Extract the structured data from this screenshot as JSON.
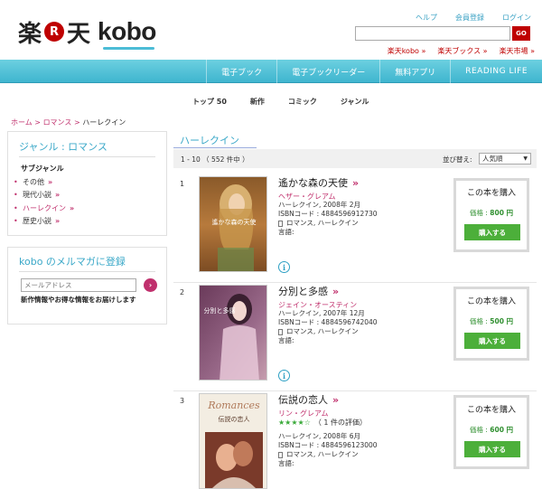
{
  "header": {
    "logo_rakuten": "楽",
    "logo_r": "R",
    "logo_ten": "天",
    "logo_kobo": "kobo",
    "top_links": [
      "ヘルプ",
      "会員登録",
      "ログイン"
    ],
    "search_value": "",
    "search_button": "GO",
    "site_links": [
      "楽天kobo »",
      "楽天ブックス »",
      "楽天市場 »"
    ]
  },
  "nav": {
    "items": [
      "電子ブック",
      "電子ブックリーダー",
      "無料アプリ",
      "READING LIFE"
    ],
    "color": "#4cbcd6"
  },
  "subnav": [
    "トップ 50",
    "新作",
    "コミック",
    "ジャンル"
  ],
  "breadcrumb": {
    "home": "ホーム",
    "sep1": " > ",
    "romance": "ロマンス",
    "sep2": " > ",
    "current": "ハーレクイン"
  },
  "sidebar": {
    "genre_title": "ジャンル : ロマンス",
    "subgenre_label": "サブジャンル",
    "subgenres": [
      {
        "label": "その他",
        "arrow": "»"
      },
      {
        "label": "現代小説",
        "arrow": "»"
      },
      {
        "label": "ハーレクイン",
        "arrow": "»"
      },
      {
        "label": "歴史小説",
        "arrow": "»"
      }
    ],
    "bullet": "•",
    "newsletter_title": "kobo のメルマガに登録",
    "email_placeholder": "メールアドレス",
    "newsletter_desc": "新作情報やお得な情報をお届けします",
    "go_arrow": "›"
  },
  "main": {
    "title": "ハーレクイン",
    "results": "1 - 10 （ 552 件中 ）",
    "sort_label": "並び替え:",
    "sort_value": "人気順",
    "sort_chevron": "▼"
  },
  "books": [
    {
      "num": "1",
      "title": "遙かな森の天使",
      "arrow": "»",
      "author": "ヘザー・グレアム",
      "rating": "",
      "publisher": "ハーレクイン, 2008年 2月",
      "isbn": "ISBNコード : 4884596912730",
      "genres": "ロマンス, ハーレクイン",
      "lang": "言語:",
      "cover_text": "遙かな森の天使",
      "buy_title": "この本を購入",
      "price_label": "価格 :",
      "price": "800 円",
      "buy_button": "購入する"
    },
    {
      "num": "2",
      "title": "分別と多感",
      "arrow": "»",
      "author": "ジェイン・オースティン",
      "rating": "",
      "publisher": "ハーレクイン, 2007年 12月",
      "isbn": "ISBNコード : 4884596742040",
      "genres": "ロマンス, ハーレクイン",
      "lang": "言語:",
      "cover_text": "分別と多感",
      "buy_title": "この本を購入",
      "price_label": "価格 :",
      "price": "500 円",
      "buy_button": "購入する"
    },
    {
      "num": "3",
      "title": "伝説の恋人",
      "arrow": "»",
      "author": "リン・グレアム",
      "stars": "★★★★☆",
      "rating": "（ 1  件の評価）",
      "publisher": "ハーレクイン, 2008年 6月",
      "isbn": "ISBNコード : 4884596123000",
      "genres": "ロマンス, ハーレクイン",
      "lang": "言語:",
      "cover_banner": "Romances",
      "cover_text": "伝説の恋人",
      "buy_title": "この本を購入",
      "price_label": "価格 :",
      "price": "600 円",
      "buy_button": "購入する"
    }
  ]
}
